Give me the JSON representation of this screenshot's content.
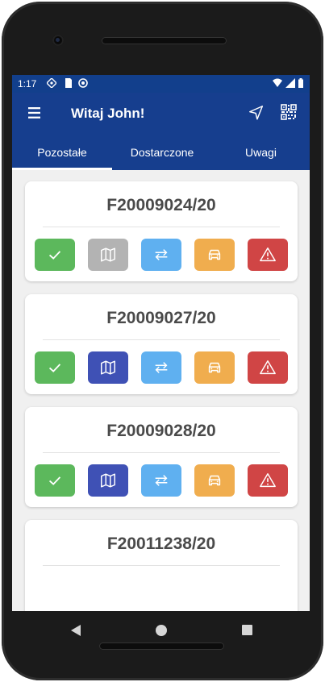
{
  "status": {
    "time": "1:17"
  },
  "app": {
    "title": "Witaj John!"
  },
  "tabs": [
    {
      "label": "Pozostałe",
      "active": true
    },
    {
      "label": "Dostarczone",
      "active": false
    },
    {
      "label": "Uwagi",
      "active": false
    }
  ],
  "cards": [
    {
      "title": "F20009024/20",
      "map_enabled": false
    },
    {
      "title": "F20009027/20",
      "map_enabled": true
    },
    {
      "title": "F20009028/20",
      "map_enabled": true
    },
    {
      "title": "F20011238/20",
      "map_enabled": true
    }
  ],
  "icons": {
    "menu": "menu-icon",
    "navigation": "navigation-arrow-icon",
    "qr": "qr-code-icon",
    "check": "check-icon",
    "map": "map-icon",
    "swap": "swap-arrows-icon",
    "car": "car-icon",
    "warning": "warning-icon"
  },
  "colors": {
    "appbar": "#163e8e",
    "statusbar": "#123f8c",
    "check": "#5cb85c",
    "map_active": "#3f51b5",
    "map_disabled": "#b3b3b3",
    "swap": "#5fb0f0",
    "car": "#f0ad4e",
    "warning": "#d04545"
  }
}
